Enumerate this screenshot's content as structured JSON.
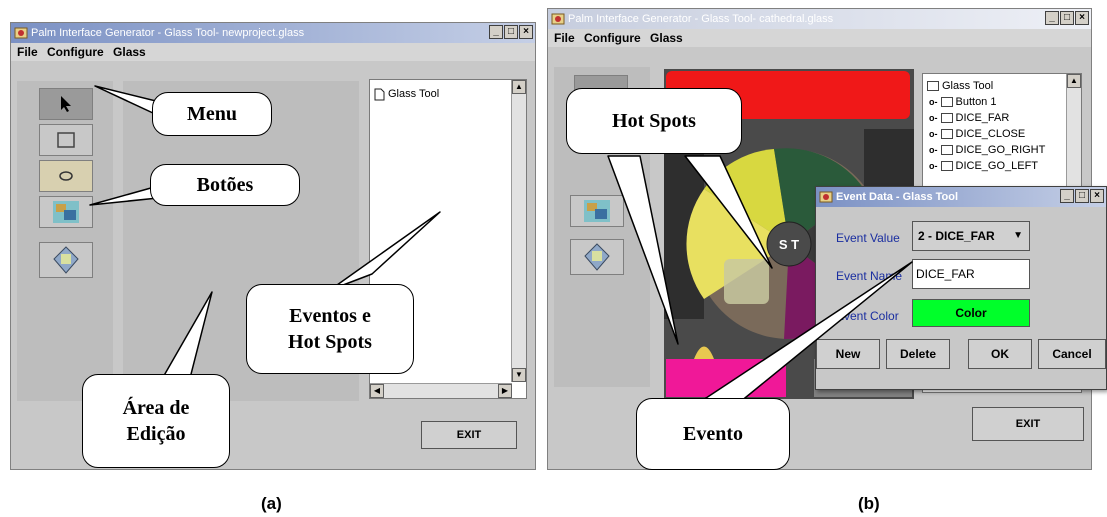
{
  "window_a": {
    "title": "Palm Interface Generator - Glass Tool- newproject.glass",
    "menu": [
      "File",
      "Configure",
      "Glass"
    ],
    "tree_root": "Glass Tool",
    "exit_label": "EXIT",
    "caption": "(a)"
  },
  "window_b": {
    "title": "Palm Interface Generator - Glass Tool- cathedral.glass",
    "menu": [
      "File",
      "Configure",
      "Glass"
    ],
    "tree_root": "Glass Tool",
    "tree_items": [
      "Button 1",
      "DICE_FAR",
      "DICE_CLOSE",
      "DICE_GO_RIGHT",
      "DICE_GO_LEFT"
    ],
    "exit_label": "EXIT",
    "caption": "(b)",
    "board_center_label": "S T"
  },
  "dialog": {
    "title": "Event Data - Glass Tool",
    "event_value_label": "Event Value",
    "event_value": "2 - DICE_FAR",
    "event_name_label": "Event Name",
    "event_name_value": "DICE_FAR",
    "event_color_label": "Event Color",
    "color_button_label": "Color",
    "color_value": "#00ff2a",
    "buttons": [
      "New",
      "Delete",
      "OK",
      "Cancel"
    ]
  },
  "callouts": {
    "menu": "Menu",
    "buttons": "Botões",
    "events_line1": "Eventos e",
    "events_line2": "Hot Spots",
    "edit_line1": "Área de",
    "edit_line2": "Edição",
    "hotspots": "Hot Spots",
    "event": "Evento"
  }
}
